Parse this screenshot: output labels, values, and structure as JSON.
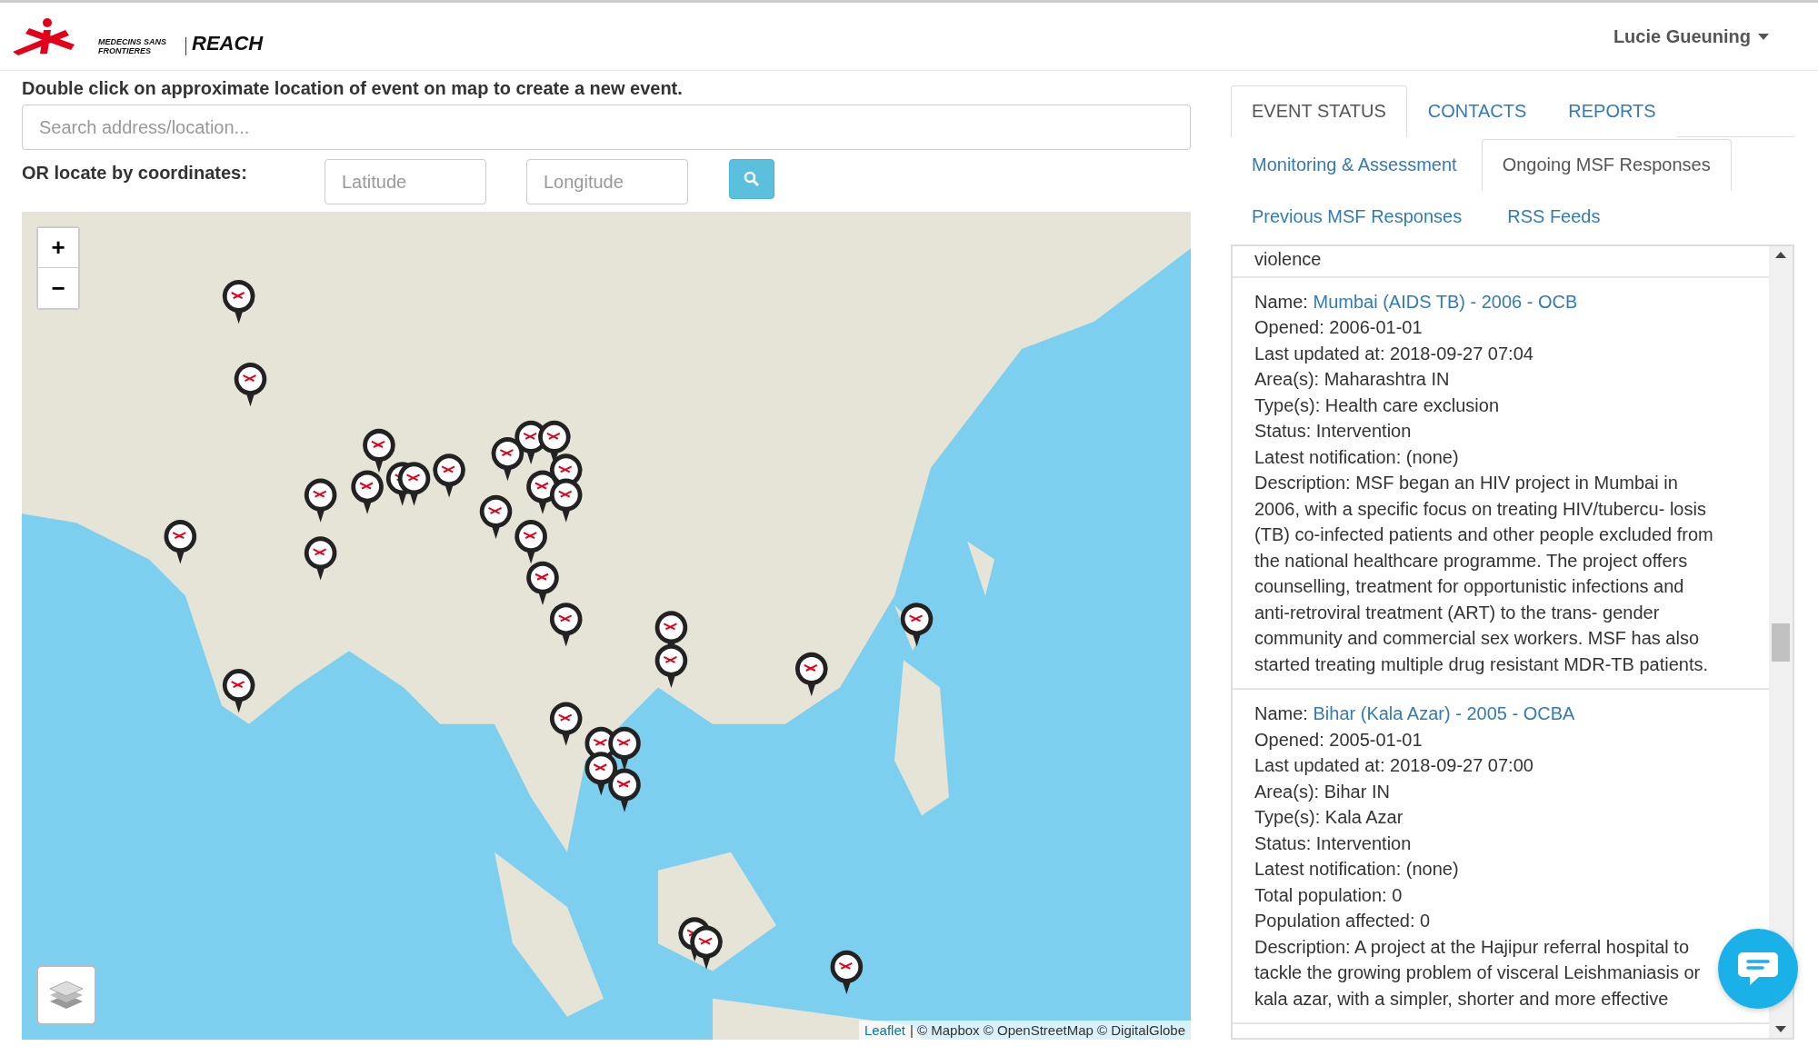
{
  "header": {
    "logo_text": "MEDECINS SANS FRONTIERES",
    "app_name": "REACH",
    "user_menu": "Lucie Gueuning"
  },
  "locator": {
    "instruction": "Double click on approximate location of event on map to create a new event.",
    "search": {
      "placeholder": "Search address/location..."
    },
    "coordinates_label": "OR locate by coordinates:",
    "latitude": {
      "placeholder": "Latitude"
    },
    "longitude": {
      "placeholder": "Longitude"
    }
  },
  "map": {
    "zoom_in": "+",
    "zoom_out": "−",
    "attribution_link": "Leaflet",
    "attribution": "| © Mapbox © OpenStreetMap © DigitalGlobe"
  },
  "tabs": [
    {
      "label": "EVENT STATUS",
      "selected": true
    },
    {
      "label": "CONTACTS",
      "selected": false
    },
    {
      "label": "REPORTS",
      "selected": false
    }
  ],
  "subtabs": [
    {
      "label": "Monitoring & Assessment",
      "selected": false
    },
    {
      "label": "Ongoing MSF Responses",
      "selected": true
    },
    {
      "label": "Previous MSF Responses",
      "selected": false
    },
    {
      "label": "RSS Feeds",
      "selected": false
    }
  ],
  "responses": [
    {
      "fields": [
        "violence"
      ]
    },
    {
      "name_label": "Name:",
      "name": "Mumbai (AIDS TB) - 2006 - OCB",
      "fields": [
        "Opened: 2006-01-01",
        "Last updated at: 2018-09-27 07:04",
        "Area(s): Maharashtra IN",
        "Type(s): Health care exclusion",
        "Status: Intervention",
        "Latest notification: (none)",
        "Description: MSF began an HIV project in Mumbai in 2006, with a specific focus on treating HIV/tubercu- losis (TB) co-infected patients and other people excluded from the national healthcare programme. The project offers counselling, treatment for opportunistic infections and anti-retroviral treatment (ART) to the trans- gender community and commercial sex workers. MSF has also started treating multiple drug resistant MDR-TB patients."
      ]
    },
    {
      "name_label": "Name:",
      "name": "Bihar (Kala Azar) - 2005 - OCBA",
      "fields": [
        "Opened: 2005-01-01",
        "Last updated at: 2018-09-27 07:00",
        "Area(s): Bihar IN",
        "Type(s): Kala Azar",
        "Status: Intervention",
        "Latest notification: (none)",
        "Total population: 0",
        "Population affected: 0",
        "Description: A project at the Hajipur referral hospital to tackle the growing problem of visceral Leishmaniasis or kala azar, with a simpler, shorter and more effective"
      ]
    }
  ]
}
